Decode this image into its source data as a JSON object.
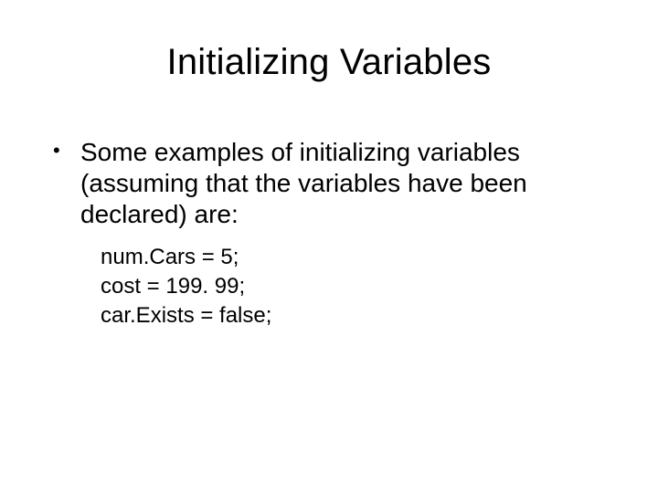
{
  "slide": {
    "title": "Initializing Variables",
    "bullet": "Some examples of initializing variables (assuming that the variables have been declared) are:",
    "code": {
      "line1": "num.Cars = 5;",
      "line2": "cost = 199. 99;",
      "line3": "car.Exists = false;"
    }
  }
}
